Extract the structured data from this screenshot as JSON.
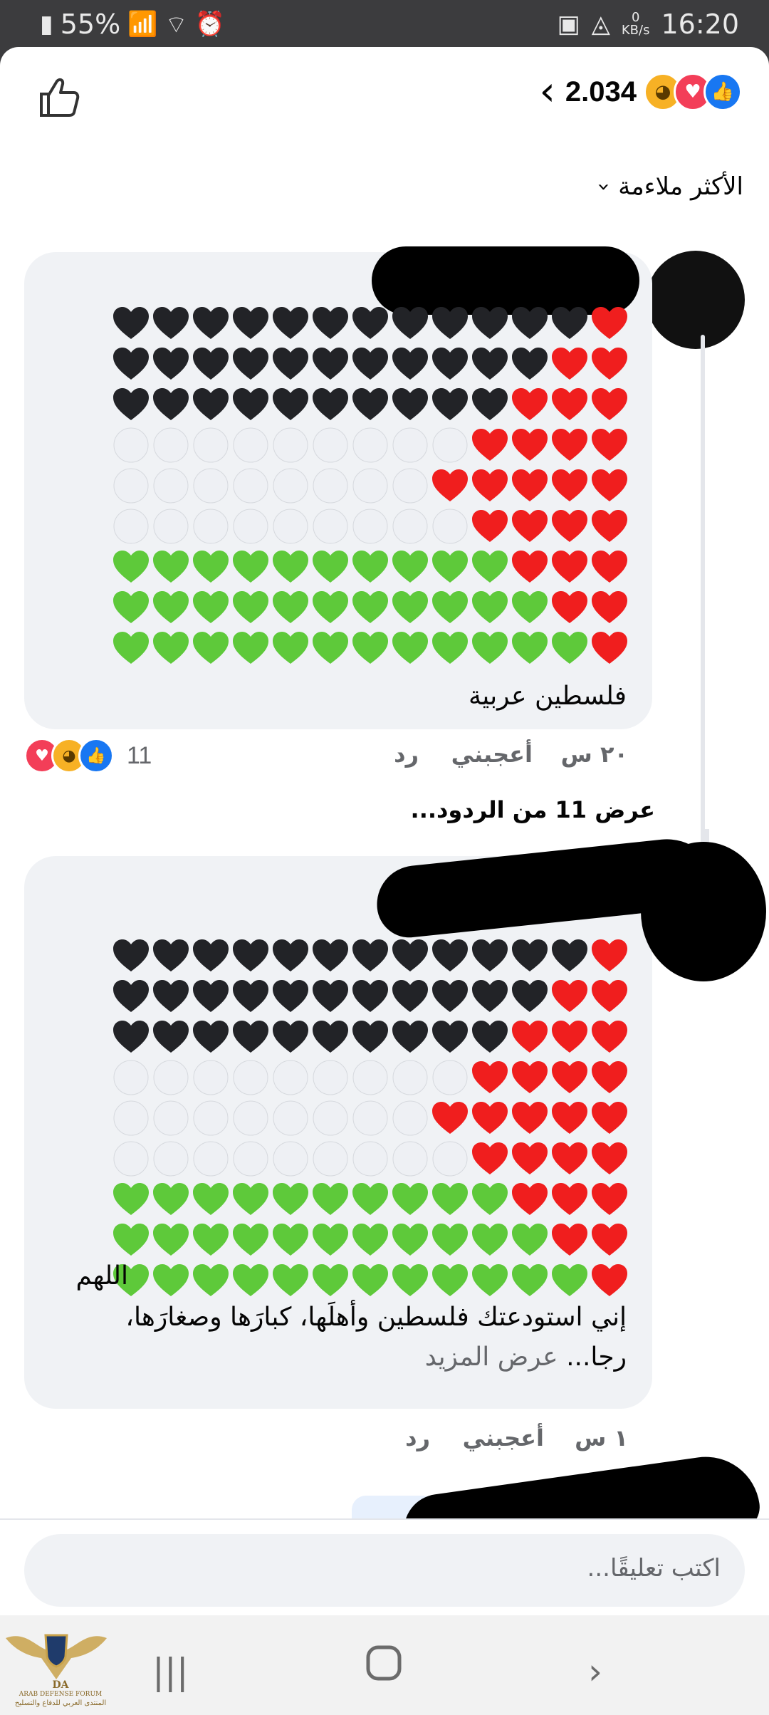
{
  "status_bar": {
    "battery": "55%",
    "time": "16:20",
    "kb_value": "0",
    "kb_unit": "KB/s"
  },
  "header": {
    "reaction_count": "2.034"
  },
  "sort": {
    "label": "الأكثر ملاءمة"
  },
  "comments": [
    {
      "text": "فلسطين عربية",
      "time": "٢٠ س",
      "like_label": "أعجبني",
      "reply_label": "رد",
      "reaction_count": "11",
      "view_replies": "عرض 11 من الردود..."
    },
    {
      "line1": "اللهم",
      "line2": "إني استودعتك فلسطين وأهلَها، كبارَها وصغارَها،",
      "line3_prefix": "رجا...",
      "see_more": "عرض المزيد",
      "time": "١ س",
      "like_label": "أعجبني",
      "reply_label": "رد"
    }
  ],
  "composer": {
    "placeholder": "اكتب تعليقًا..."
  },
  "flag_colors": {
    "black": "#222327",
    "red": "#f01e1e",
    "white": "#eef0f4",
    "green": "#5ec93a"
  },
  "watermark": {
    "line1": "ARAB DEFENSE FORUM",
    "line2": "المنتدى العربي للدفاع والتسليح",
    "mark": "DA"
  }
}
